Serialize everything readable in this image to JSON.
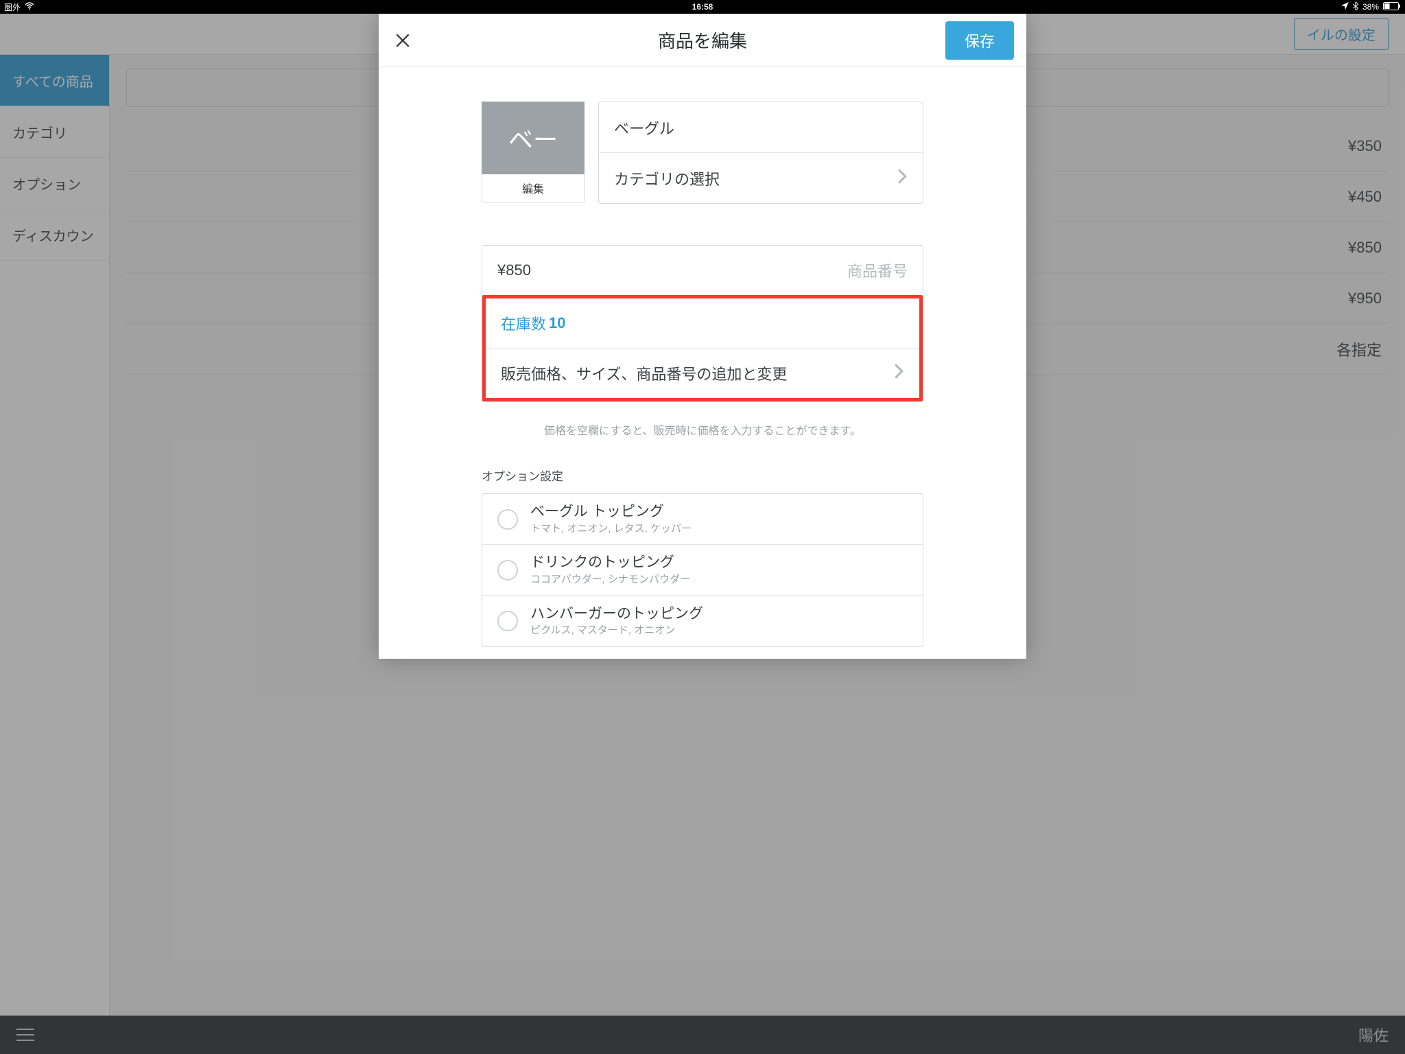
{
  "status": {
    "carrier": "圏外",
    "time": "16:58",
    "battery_pct": "38%"
  },
  "background": {
    "settings_btn": "イルの設定",
    "sidebar": [
      "すべての商品",
      "カテゴリ",
      "オプション",
      "ディスカウン"
    ],
    "list_prices": [
      "¥350",
      "¥450",
      "¥850",
      "¥950",
      "各指定"
    ],
    "footer_user": "陽佐"
  },
  "modal": {
    "title": "商品を編集",
    "save": "保存",
    "tile_text": "ベー",
    "tile_edit": "編集",
    "item_name": "ベーグル",
    "category_label": "カテゴリの選択",
    "price": "¥850",
    "sku_placeholder": "商品番号",
    "stock_label": "在庫数",
    "stock_value": "10",
    "variants_label": "販売価格、サイズ、商品番号の追加と変更",
    "help": "価格を空欄にすると、販売時に価格を入力することができます。",
    "options_header": "オプション設定",
    "options": [
      {
        "title": "ベーグル トッピング",
        "sub": "トマト, オニオン, レタス, ケッパー"
      },
      {
        "title": "ドリンクのトッピング",
        "sub": "ココアパウダー, シナモンパウダー"
      },
      {
        "title": "ハンバーガーのトッピング",
        "sub": "ピクルス, マスタード, オニオン"
      }
    ]
  }
}
